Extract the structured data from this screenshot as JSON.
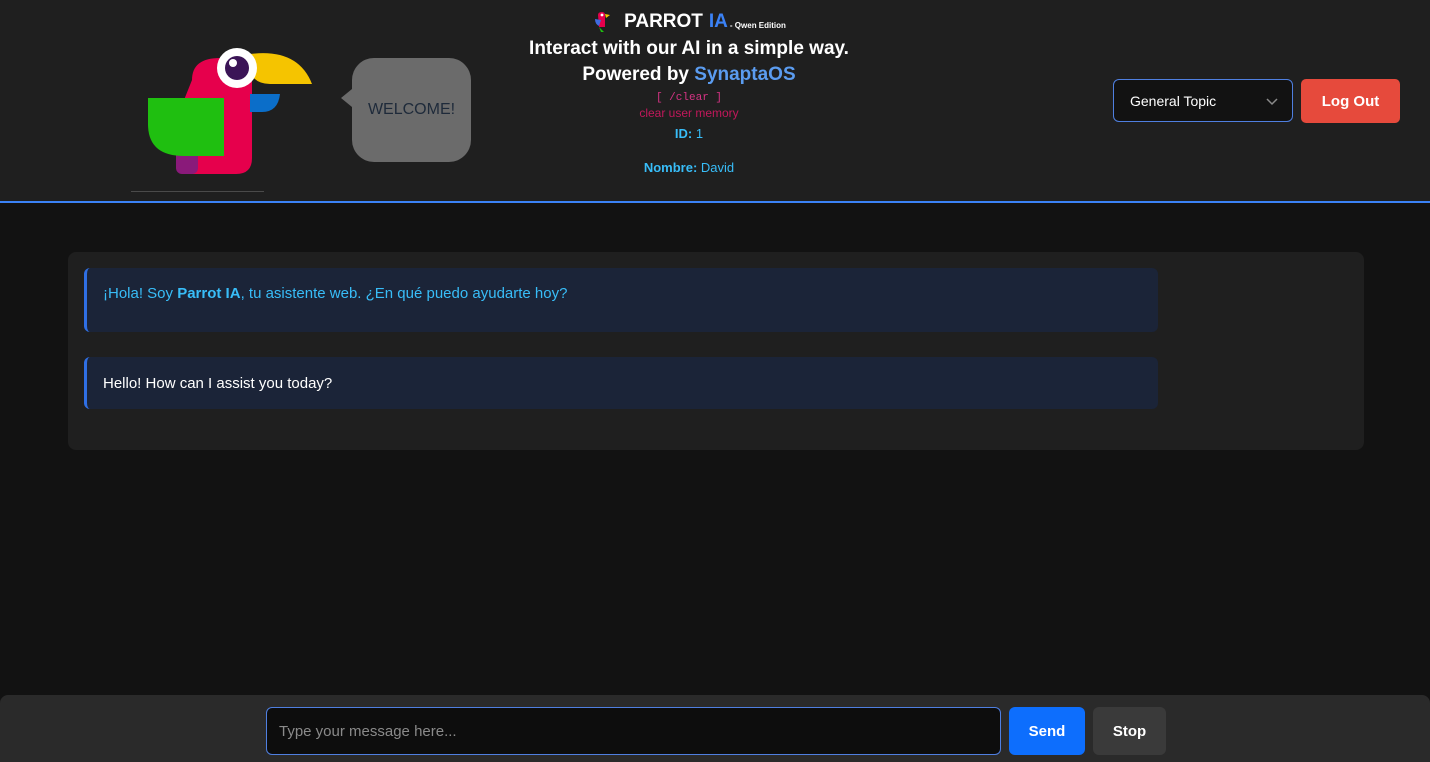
{
  "header": {
    "title_main": "PARROT",
    "title_accent": "IA",
    "title_edition": "- Qwen Edition",
    "tagline": "Interact with our AI in a simple way.",
    "powered_prefix": "Powered by ",
    "powered_brand": "SynaptaOS",
    "clear_command": "[ /clear ]",
    "clear_description": "clear user memory",
    "id_label": "ID:",
    "id_value": " 1",
    "name_label": "Nombre:",
    "name_value": " David",
    "welcome_bubble": "WELCOME!",
    "topic_select_value": "General Topic",
    "logout_label": "Log Out"
  },
  "messages": [
    {
      "role": "assistant",
      "prefix": "¡Hola! Soy ",
      "bold": "Parrot IA",
      "suffix": ", tu asistente web. ¿En qué puedo ayudarte hoy?"
    },
    {
      "role": "assistant",
      "text": "Hello! How can I assist you today?"
    }
  ],
  "composer": {
    "placeholder": "Type your message here...",
    "value": "",
    "send_label": "Send",
    "stop_label": "Stop"
  },
  "colors": {
    "accent_blue": "#3b82f6",
    "send_blue": "#0d6efd",
    "logout_red": "#e64a3c",
    "info_cyan": "#38bdf8",
    "clear_pink": "#d63384",
    "parrot_pink": "#e6004c",
    "parrot_green": "#1fbf10",
    "parrot_yellow": "#f5c400"
  },
  "icons": {
    "logo": "parrot-logo-icon",
    "title": "parrot-icon",
    "select": "chevron-down-icon"
  }
}
